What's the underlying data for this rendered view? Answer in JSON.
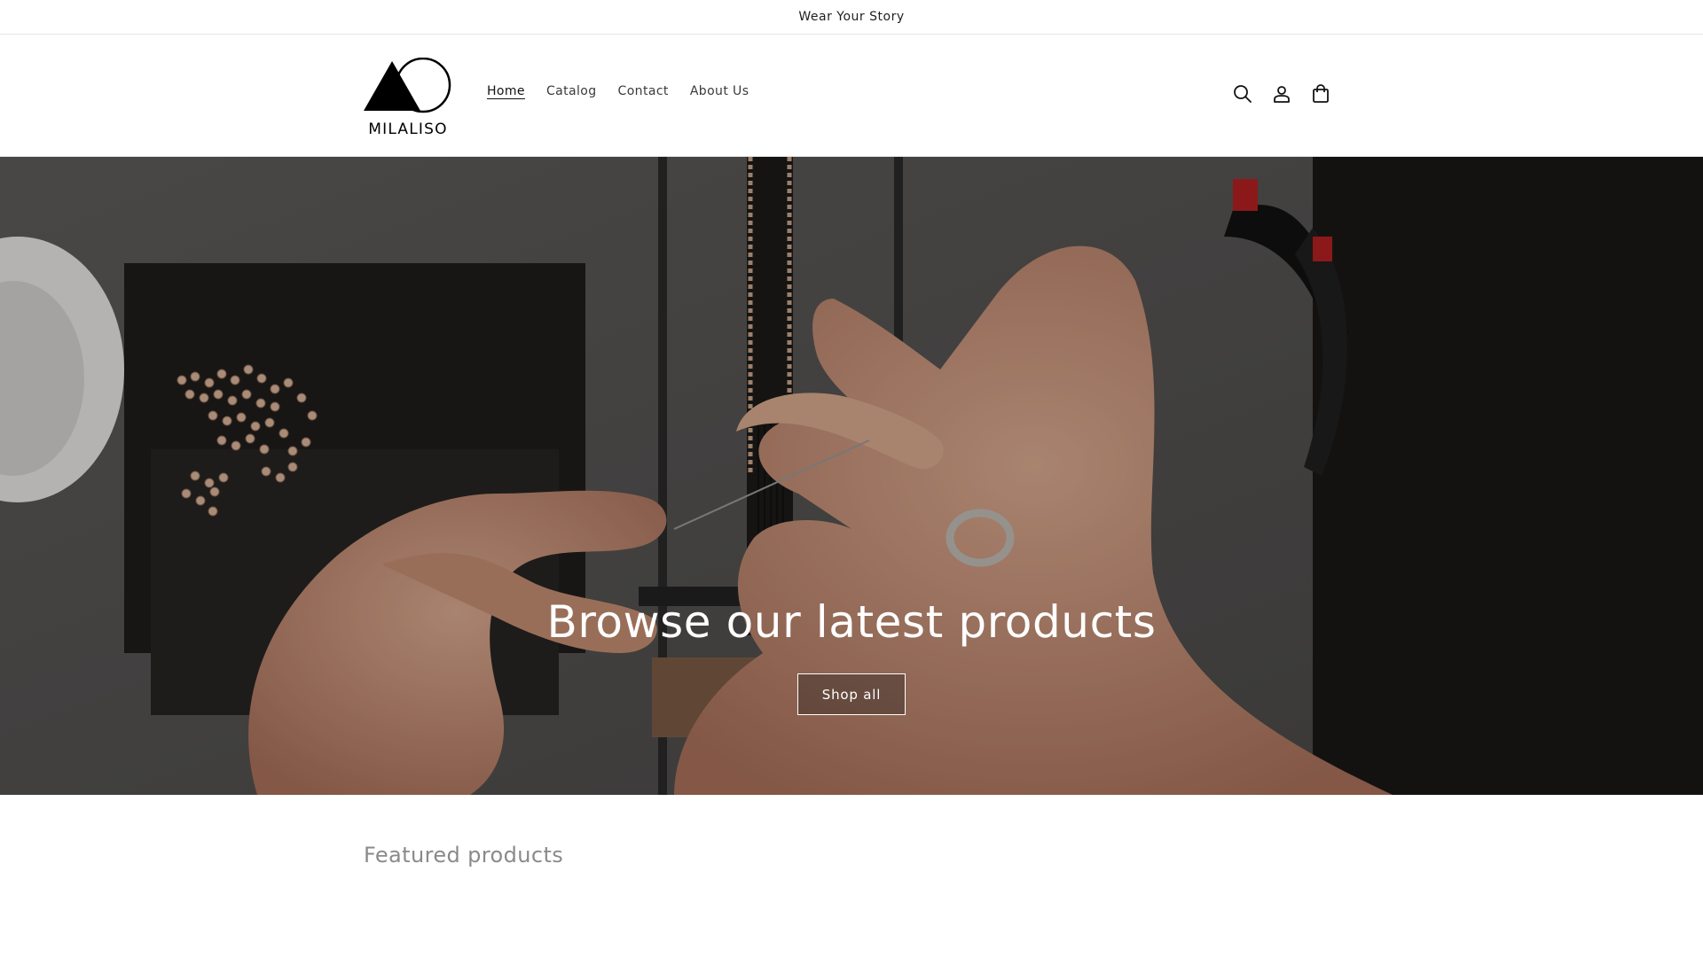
{
  "announcement": {
    "text": "Wear Your Story"
  },
  "header": {
    "logo_text": "MILALISO",
    "nav": [
      {
        "label": "Home",
        "active": true
      },
      {
        "label": "Catalog",
        "active": false
      },
      {
        "label": "Contact",
        "active": false
      },
      {
        "label": "About Us",
        "active": false
      }
    ],
    "icons": [
      "search-icon",
      "account-icon",
      "cart-icon"
    ]
  },
  "hero": {
    "title": "Browse our latest products",
    "button_label": "Shop all"
  },
  "featured": {
    "title": "Featured products"
  },
  "colors": {
    "text": "#121212",
    "muted": "#8a8a8a",
    "hero_overlay": "#000000"
  }
}
